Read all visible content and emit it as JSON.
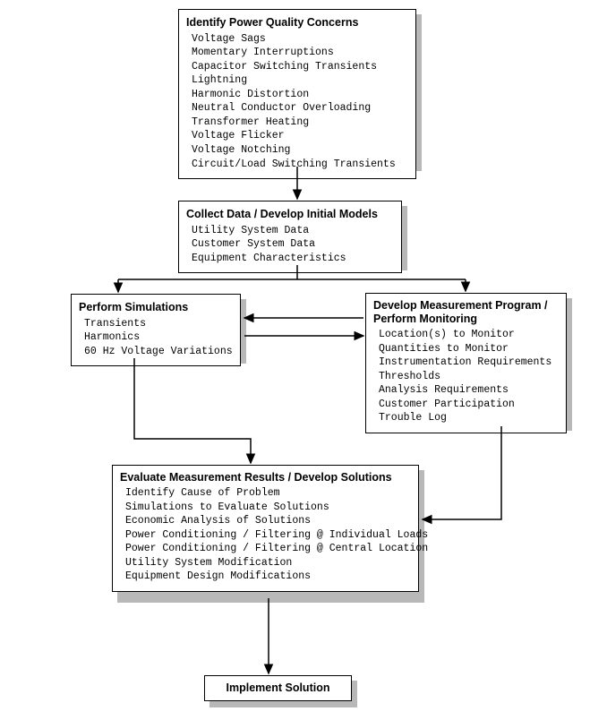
{
  "boxes": {
    "identify": {
      "title": "Identify Power Quality Concerns",
      "items": [
        "Voltage Sags",
        "Momentary Interruptions",
        "Capacitor Switching Transients",
        "Lightning",
        "Harmonic Distortion",
        "Neutral Conductor Overloading",
        "Transformer Heating",
        "Voltage Flicker",
        "Voltage Notching",
        "Circuit/Load Switching Transients"
      ]
    },
    "collect": {
      "title": "Collect Data / Develop Initial Models",
      "items": [
        "Utility System Data",
        "Customer System Data",
        "Equipment Characteristics"
      ]
    },
    "simulate": {
      "title": "Perform Simulations",
      "items": [
        "Transients",
        "Harmonics",
        "60 Hz Voltage Variations"
      ]
    },
    "monitor": {
      "title": "Develop Measurement Program / Perform Monitoring",
      "items": [
        "Location(s) to Monitor",
        "Quantities to Monitor",
        "Instrumentation Requirements",
        "Thresholds",
        "Analysis Requirements",
        "Customer Participation",
        "Trouble Log"
      ]
    },
    "evaluate": {
      "title": "Evaluate Measurement Results / Develop Solutions",
      "items": [
        "Identify Cause of Problem",
        "Simulations to Evaluate Solutions",
        "Economic Analysis of Solutions",
        "Power Conditioning / Filtering @ Individual Loads",
        "Power Conditioning / Filtering @ Central Location",
        "Utility System Modification",
        "Equipment Design Modifications"
      ]
    },
    "implement": {
      "title": "Implement Solution",
      "items": []
    }
  }
}
